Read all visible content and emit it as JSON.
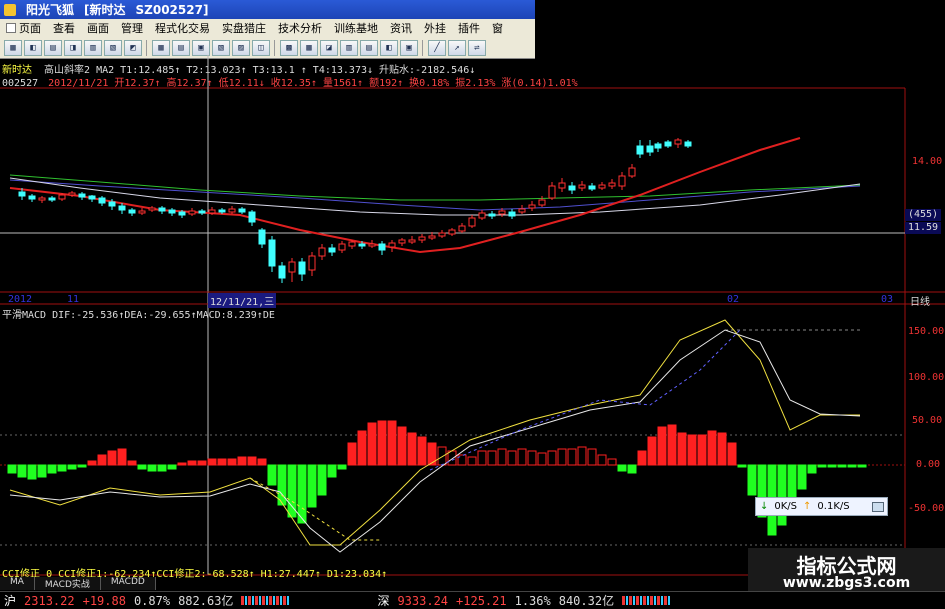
{
  "window": {
    "title_app": "阳光飞狐",
    "title_doc": "[新时达",
    "title_code": "SZ002527]"
  },
  "menu": [
    {
      "label": "页面"
    },
    {
      "label": "查看"
    },
    {
      "label": "画面"
    },
    {
      "label": "管理"
    },
    {
      "label": "程式化交易"
    },
    {
      "label": "实盘猎庄"
    },
    {
      "label": "技术分析"
    },
    {
      "label": "训练基地"
    },
    {
      "label": "资讯"
    },
    {
      "label": "外挂"
    },
    {
      "label": "插件"
    },
    {
      "label": "窗"
    }
  ],
  "header": {
    "stock_name": "新时达",
    "line1": "高山斜率2 MA2 T1:12.485↑ T2:13.023↑ T3:13.1 ↑ T4:13.373↓ 升贴水:-2182.546↓",
    "code": "002527",
    "line2": "2012/11/21 开12.37↑ 高12.37↑ 低12.11↓ 收12.35↑ 量1561↑ 额192↑ 换0.18% 振2.13% 涨(0.14)1.01%"
  },
  "price_axis": {
    "top_label": "14.00",
    "sel_label": "(455)",
    "sel_value": "11.59"
  },
  "date_axis": {
    "d1": "2012",
    "d2": "11",
    "cursor": "12/11/21,三",
    "d3": "02",
    "d4": "03",
    "period": "日线"
  },
  "macd_line": "平滑MACD DIF:-25.536↑DEA:-29.655↑MACD:8.239↑DE",
  "macd_axis": [
    "150.00",
    "100.00",
    "50.00",
    "0.00",
    "-50.00"
  ],
  "cci_line": "CCI修正 0 CCI修正1:-62.234↑CCI修正2:-68.528↑ H1:27.447↑ D1:23.034↑",
  "tabs": [
    {
      "label": "MA"
    },
    {
      "label": "MACD实战"
    },
    {
      "label": "MACDD"
    }
  ],
  "status": {
    "sh_label": "沪",
    "sh_index": "2313.22",
    "sh_chg": "+19.88",
    "sh_pct": "0.87%",
    "sh_amt": "882.63亿",
    "sz_label": "深",
    "sz_index": "9333.24",
    "sz_chg": "+125.21",
    "sz_pct": "1.36%",
    "sz_amt": "840.32亿"
  },
  "speed_popup": {
    "down": "0K/S",
    "up": "0.1K/S"
  },
  "watermark": {
    "line1": "指标公式网",
    "line2": "www.zbgs3.com"
  },
  "colors": {
    "up": "#ff3030",
    "down": "#40ffff",
    "ma_red": "#e02020",
    "ma_white": "#d8d8e8",
    "ma_green": "#30c030",
    "ma_blue": "#5050d0"
  }
}
